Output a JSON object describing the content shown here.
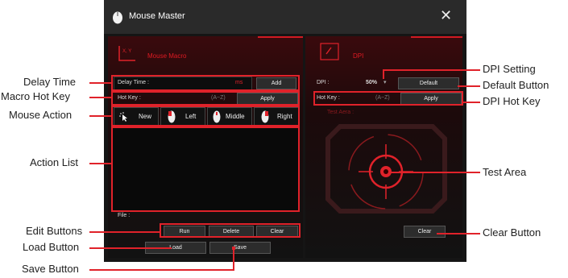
{
  "window": {
    "title": "Mouse Master",
    "close_glyph": "✕"
  },
  "macro": {
    "header": "Mouse Macro",
    "header_icon_text": "X, Y",
    "delay_label": "Delay Time :",
    "delay_unit": "ms",
    "add_label": "Add",
    "hotkey_label": "Hot Key :",
    "hotkey_hint": "(A~Z)",
    "apply_label": "Apply",
    "actions": [
      "New",
      "Left",
      "Middle",
      "Right"
    ],
    "file_label": "File :",
    "run_label": "Run",
    "delete_label": "Delete",
    "clear_label": "Clear",
    "load_label": "Load",
    "save_label": "Save"
  },
  "dpi": {
    "header": "DPI",
    "dpi_label": "DPI :",
    "dpi_value": "50%",
    "default_label": "Default",
    "hotkey_label": "Hot Key :",
    "hotkey_hint": "(A~Z)",
    "apply_label": "Apply",
    "test_area_label": "Test Aera :",
    "clear_label": "Clear"
  },
  "callouts": {
    "delay_time": "Delay Time",
    "macro_hot_key": "Macro Hot Key",
    "mouse_action": "Mouse Action",
    "action_list": "Action List",
    "edit_buttons": "Edit Buttons",
    "load_button": "Load Button",
    "save_button": "Save Button",
    "dpi_setting": "DPI Setting",
    "default_button": "Default Button",
    "dpi_hot_key": "DPI Hot Key",
    "test_area": "Test Area",
    "clear_button": "Clear Button"
  },
  "colors": {
    "accent": "#e0222a",
    "window_bg": "#151515"
  }
}
